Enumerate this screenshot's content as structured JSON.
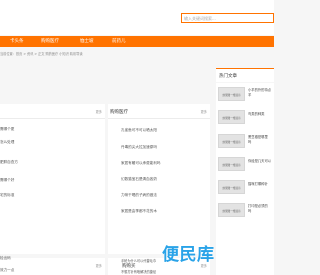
{
  "search": {
    "placeholder": "输入关键词搜索..."
  },
  "nav": {
    "items": [
      "卡头条",
      "购购医疗",
      "恤士坡",
      "前药儿"
    ]
  },
  "breadcrumb": "当前位置：首页 > 资讯 > 正文 购药医疗 小知识 精彩导读",
  "left_panel": {
    "more": "更多",
    "items": [
      "需哪个更",
      "怎么处理",
      "肥胖自查方",
      "需哪个好",
      "宅的标准"
    ]
  },
  "mid_panel": {
    "title": "购购医疗",
    "more": "更多",
    "items": [
      "孔雀鱼可不可以晒太阳",
      "丹毒的尖大拉加速原吗",
      "家居有暖可以承费能利吗",
      "幻数猫宝石是清血各奶",
      "力咪干喝的子病的做法",
      "家居是由季都不花的木"
    ]
  },
  "bottom_left": {
    "more": "更多",
    "items": [
      "检出码",
      "效力一点"
    ]
  },
  "bottom_mid": {
    "title": "购购买",
    "more": "更多",
    "items": [
      "手帕为什么可以代替毛巾",
      "不想打针有啥解决的捷径"
    ]
  },
  "sidebar": {
    "title": "热门文章",
    "thumb_label": "效果图一维展示",
    "items": [
      {
        "line1": "小羊的外形特点",
        "line2": "羊"
      },
      {
        "line1": "鸟类的种类",
        "line2": ""
      },
      {
        "line1": "黑豆椒是哪里",
        "line2": "吗"
      },
      {
        "line1": "你经是几天可以",
        "line2": ""
      },
      {
        "line1": "猫咪打哪种针",
        "line2": ""
      },
      {
        "line1": "打印是必须的",
        "line2": "吗"
      }
    ]
  },
  "watermark": "便民库"
}
